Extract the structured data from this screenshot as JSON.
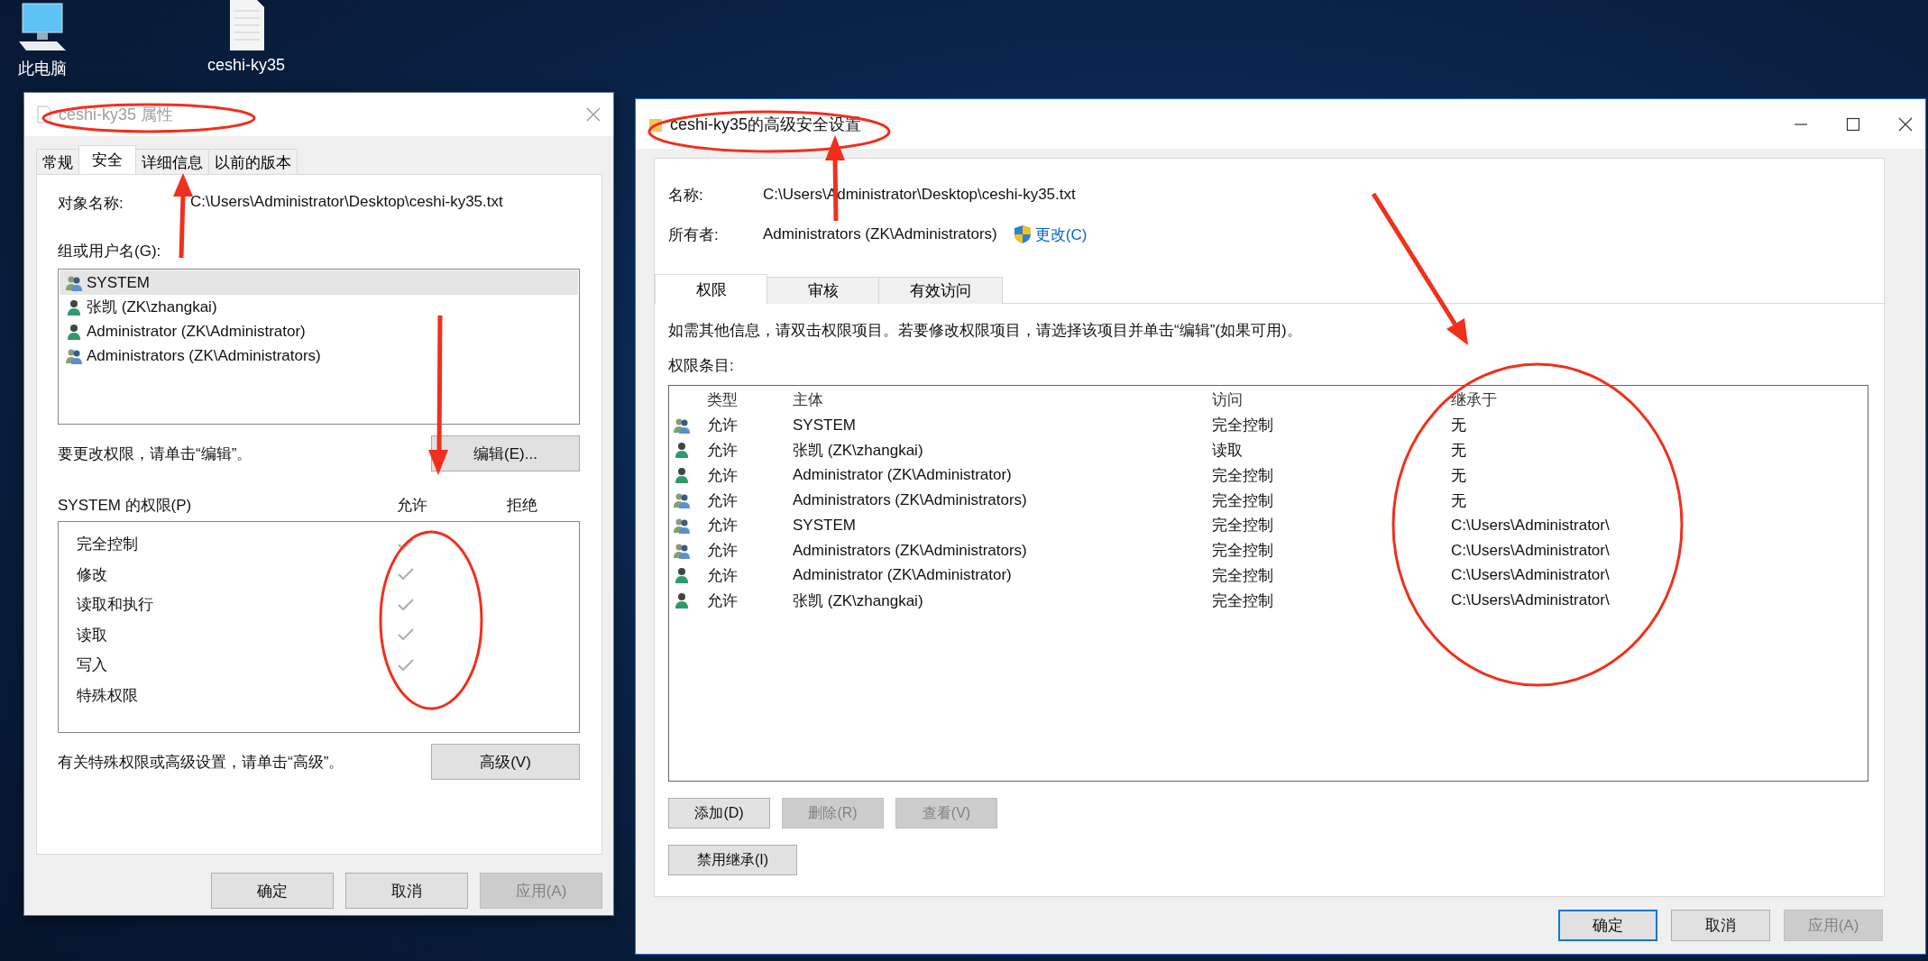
{
  "desktop": {
    "icons": [
      {
        "label": "此电脑",
        "kind": "computer"
      },
      {
        "label": "ceshi-ky35",
        "kind": "file"
      }
    ]
  },
  "properties_dialog": {
    "title": "ceshi-ky35 属性",
    "tabs": [
      {
        "label": "常规",
        "selected": false
      },
      {
        "label": "安全",
        "selected": true
      },
      {
        "label": "详细信息",
        "selected": false
      },
      {
        "label": "以前的版本",
        "selected": false
      }
    ],
    "object_name_label": "对象名称:",
    "object_name": "C:\\Users\\Administrator\\Desktop\\ceshi-ky35.txt",
    "groups_label": "组或用户名(G):",
    "principals": [
      {
        "name": "SYSTEM",
        "kind": "group",
        "selected": true
      },
      {
        "name": "张凯 (ZK\\zhangkai)",
        "kind": "user",
        "selected": false
      },
      {
        "name": "Administrator (ZK\\Administrator)",
        "kind": "user",
        "selected": false
      },
      {
        "name": "Administrators (ZK\\Administrators)",
        "kind": "group",
        "selected": false
      }
    ],
    "edit_hint": "要更改权限，请单击“编辑”。",
    "edit_button": "编辑(E)...",
    "permissions_label": "SYSTEM 的权限(P)",
    "allow_header": "允许",
    "deny_header": "拒绝",
    "permissions": [
      {
        "name": "完全控制",
        "allow": true,
        "deny": false
      },
      {
        "name": "修改",
        "allow": true,
        "deny": false
      },
      {
        "name": "读取和执行",
        "allow": true,
        "deny": false
      },
      {
        "name": "读取",
        "allow": true,
        "deny": false
      },
      {
        "name": "写入",
        "allow": true,
        "deny": false
      },
      {
        "name": "特殊权限",
        "allow": false,
        "deny": false
      }
    ],
    "advanced_hint": "有关特殊权限或高级设置，请单击“高级”。",
    "advanced_button": "高级(V)",
    "buttons": [
      {
        "label": "确定",
        "disabled": false
      },
      {
        "label": "取消",
        "disabled": false
      },
      {
        "label": "应用(A)",
        "disabled": true
      }
    ]
  },
  "advanced_dialog": {
    "title": "ceshi-ky35的高级安全设置",
    "name_label": "名称:",
    "name": "C:\\Users\\Administrator\\Desktop\\ceshi-ky35.txt",
    "owner_label": "所有者:",
    "owner": "Administrators (ZK\\Administrators)",
    "change_link": "更改(C)",
    "tabs": [
      {
        "label": "权限",
        "selected": true
      },
      {
        "label": "审核",
        "selected": false
      },
      {
        "label": "有效访问",
        "selected": false
      }
    ],
    "info": "如需其他信息，请双击权限项目。若要修改权限项目，请选择该项目并单击“编辑”(如果可用)。",
    "entries_label": "权限条目:",
    "columns": [
      "类型",
      "主体",
      "访问",
      "继承于"
    ],
    "rows": [
      {
        "kind": "group",
        "type": "允许",
        "principal": "SYSTEM",
        "access": "完全控制",
        "inherited_from": "无"
      },
      {
        "kind": "user",
        "type": "允许",
        "principal": "张凯 (ZK\\zhangkai)",
        "access": "读取",
        "inherited_from": "无"
      },
      {
        "kind": "user",
        "type": "允许",
        "principal": "Administrator (ZK\\Administrator)",
        "access": "完全控制",
        "inherited_from": "无"
      },
      {
        "kind": "group",
        "type": "允许",
        "principal": "Administrators (ZK\\Administrators)",
        "access": "完全控制",
        "inherited_from": "无"
      },
      {
        "kind": "group",
        "type": "允许",
        "principal": "SYSTEM",
        "access": "完全控制",
        "inherited_from": "C:\\Users\\Administrator\\"
      },
      {
        "kind": "group",
        "type": "允许",
        "principal": "Administrators (ZK\\Administrators)",
        "access": "完全控制",
        "inherited_from": "C:\\Users\\Administrator\\"
      },
      {
        "kind": "user",
        "type": "允许",
        "principal": "Administrator (ZK\\Administrator)",
        "access": "完全控制",
        "inherited_from": "C:\\Users\\Administrator\\"
      },
      {
        "kind": "user",
        "type": "允许",
        "principal": "张凯 (ZK\\zhangkai)",
        "access": "完全控制",
        "inherited_from": "C:\\Users\\Administrator\\"
      }
    ],
    "entry_buttons": [
      {
        "label": "添加(D)",
        "disabled": false
      },
      {
        "label": "删除(R)",
        "disabled": true
      },
      {
        "label": "查看(V)",
        "disabled": true
      }
    ],
    "disable_inheritance_button": "禁用继承(I)",
    "buttons": [
      {
        "label": "确定",
        "disabled": false,
        "default": true
      },
      {
        "label": "取消",
        "disabled": false,
        "default": false
      },
      {
        "label": "应用(A)",
        "disabled": true,
        "default": false
      }
    ]
  }
}
